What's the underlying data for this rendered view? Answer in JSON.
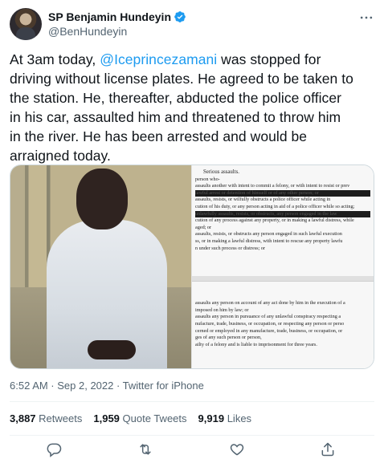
{
  "author": {
    "name": "SP Benjamin Hundeyin",
    "handle": "@BenHundeyin",
    "verified": true
  },
  "tweet": {
    "lines": [
      {
        "before": "At 3am today, ",
        "mention": "@Iceprincezamani",
        "after": " was stopped for"
      },
      {
        "text": "driving without license plates. He agreed to be taken to"
      },
      {
        "text": "the station. He, thereafter, abducted the police officer"
      },
      {
        "text": "in his car, assaulted him and threatened to throw him"
      },
      {
        "text": "in the river. He has been arrested and would be"
      },
      {
        "text": "arraigned today."
      }
    ]
  },
  "media": {
    "doc_top": [
      "Serious assaults.",
      "person who-",
      "assaults another with intent to commit a felony, or with intent to resist or prev",
      "lawful arrest or detention of himself or of any other person; or",
      "assaults, resists, or wilfully obstructs a police officer while acting in",
      "cution of his duty, or any person acting in aid of a police officer while so acting;",
      "unlawfully assaults, resists, or obstructs, any person engaged in the law",
      "cution of any process against any property, or in making a lawful distress, while",
      "aged; or",
      "assaults, resists, or obstructs any person engaged in such lawful execution",
      "ss, or in making a lawful distress, with intent to rescue any property lawfu",
      "n under such process or distress; or"
    ],
    "doc_bottom": [
      "assaults any person on account of any act done by him in the execution of a",
      "imposed on him by law; or",
      "assaults any person in pursuance of any unlawful conspiracy respecting a",
      "nufacture, trade, business, or occupation, or respecting any person or perso",
      "cerned or employed in any manufacture, trade, business, or occupation, or",
      "ges of any such person or person,",
      "ailty of a felony and is liable to imprisonment for three years."
    ]
  },
  "meta": {
    "text": "6:52 AM · Sep 2, 2022 · Twitter for iPhone"
  },
  "stats": [
    {
      "count": "3,887",
      "label": "Retweets"
    },
    {
      "count": "1,959",
      "label": "Quote Tweets"
    },
    {
      "count": "9,919",
      "label": "Likes"
    }
  ],
  "colors": {
    "accent": "#1d9bf0",
    "text": "#0f1419",
    "muted": "#536471"
  },
  "icons": [
    "more-icon",
    "verified-icon",
    "reply-icon",
    "retweet-icon",
    "like-icon",
    "share-icon"
  ]
}
